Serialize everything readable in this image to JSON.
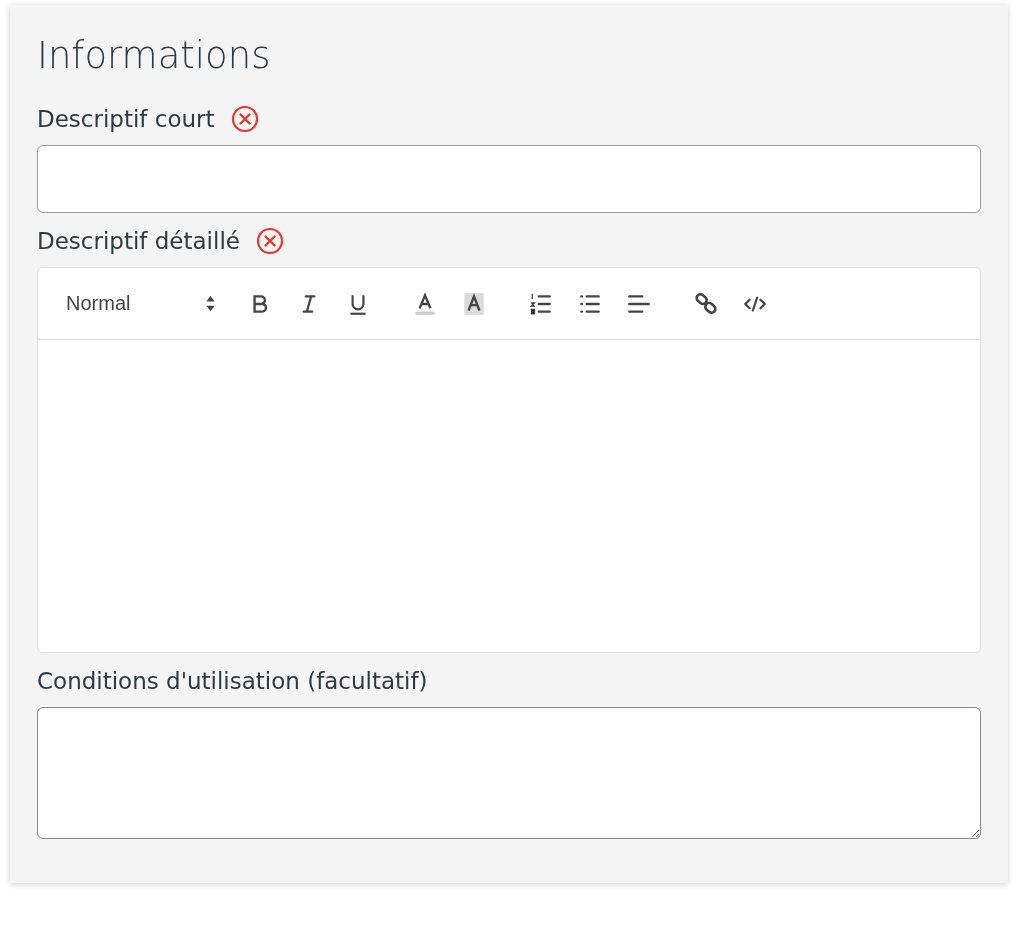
{
  "title": "Informations",
  "fields": [
    {
      "kind": "input",
      "label": "Descriptif court",
      "invalid": true
    },
    {
      "kind": "editor",
      "label": "Descriptif détaillé",
      "invalid": true,
      "toolbar": {
        "header": "Normal",
        "groups": [
          [
            {
              "kind": "bold"
            },
            {
              "kind": "italic"
            },
            {
              "kind": "underline"
            }
          ],
          [
            {
              "kind": "color"
            },
            {
              "kind": "background"
            }
          ],
          [
            {
              "kind": "ordered-list"
            },
            {
              "kind": "bullet-list"
            },
            {
              "kind": "align"
            }
          ],
          [
            {
              "kind": "link"
            },
            {
              "kind": "code"
            }
          ]
        ]
      }
    },
    {
      "kind": "textarea",
      "label": "Conditions d'utilisation (facultatif)",
      "invalid": false
    }
  ]
}
